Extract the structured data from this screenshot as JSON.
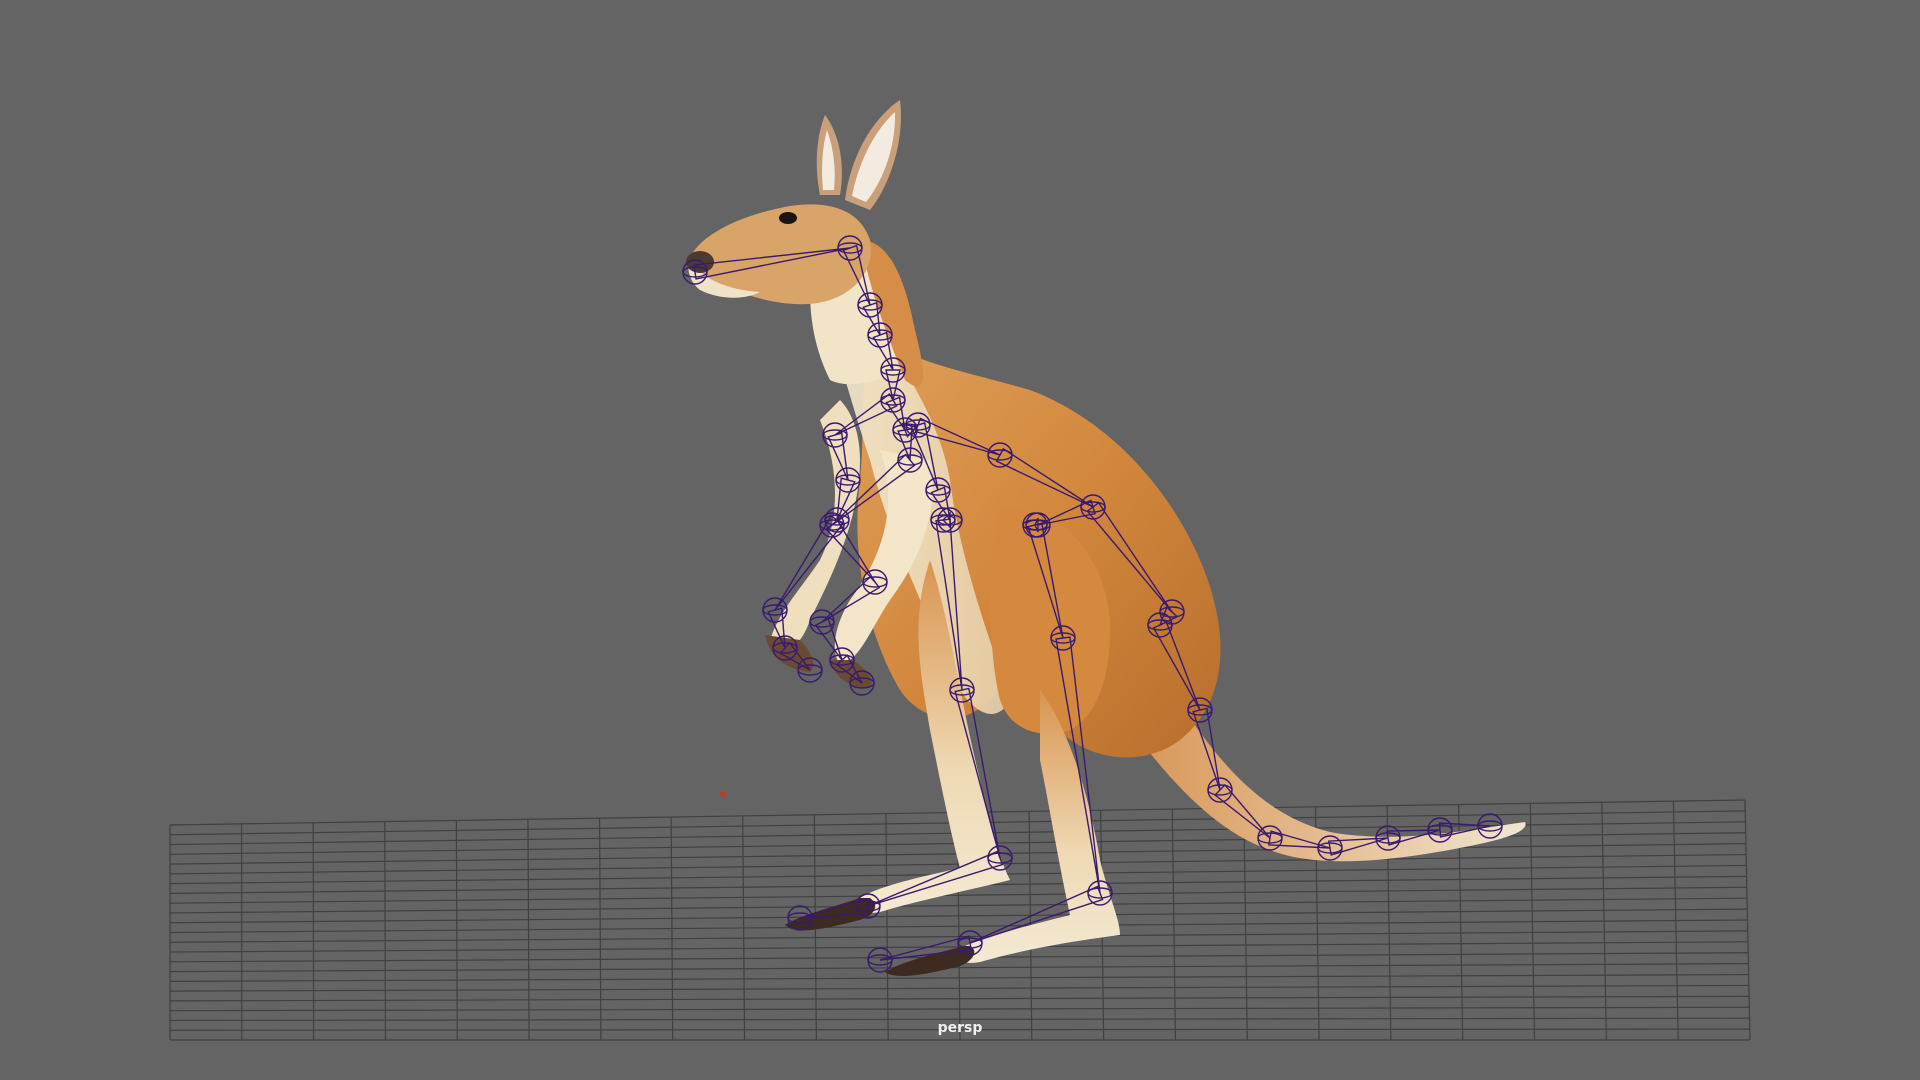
{
  "viewport": {
    "camera_label": "persp",
    "background_color": "#646464",
    "grid_color": "#3a3a3a",
    "joint_color": "#3a1a6e",
    "model": "kangaroo",
    "origin_marker_color": "#c0392b"
  }
}
